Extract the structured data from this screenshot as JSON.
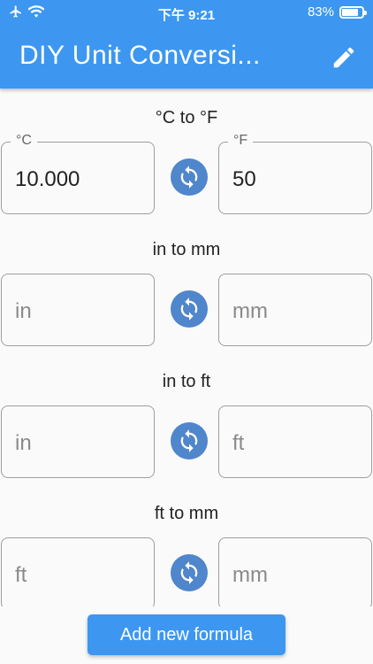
{
  "status_bar": {
    "time": "下午 9:21",
    "battery_text": "83%",
    "battery_level": 0.83
  },
  "app_bar": {
    "title": "DIY Unit Conversi...",
    "edit_icon": "pencil-icon"
  },
  "conversions": [
    {
      "title": "°C to °F",
      "left": {
        "label": "°C",
        "value": "10.000",
        "placeholder": ""
      },
      "right": {
        "label": "°F",
        "value": "50",
        "placeholder": ""
      }
    },
    {
      "title": "in to mm",
      "left": {
        "label": "",
        "value": "",
        "placeholder": "in"
      },
      "right": {
        "label": "",
        "value": "",
        "placeholder": "mm"
      }
    },
    {
      "title": "in to ft",
      "left": {
        "label": "",
        "value": "",
        "placeholder": "in"
      },
      "right": {
        "label": "",
        "value": "",
        "placeholder": "ft"
      }
    },
    {
      "title": "ft to mm",
      "left": {
        "label": "",
        "value": "",
        "placeholder": "ft"
      },
      "right": {
        "label": "",
        "value": "",
        "placeholder": "mm"
      }
    }
  ],
  "footer": {
    "add_button_label": "Add new formula"
  },
  "colors": {
    "primary": "#3d97f0",
    "swap_button": "#4f86cc"
  }
}
